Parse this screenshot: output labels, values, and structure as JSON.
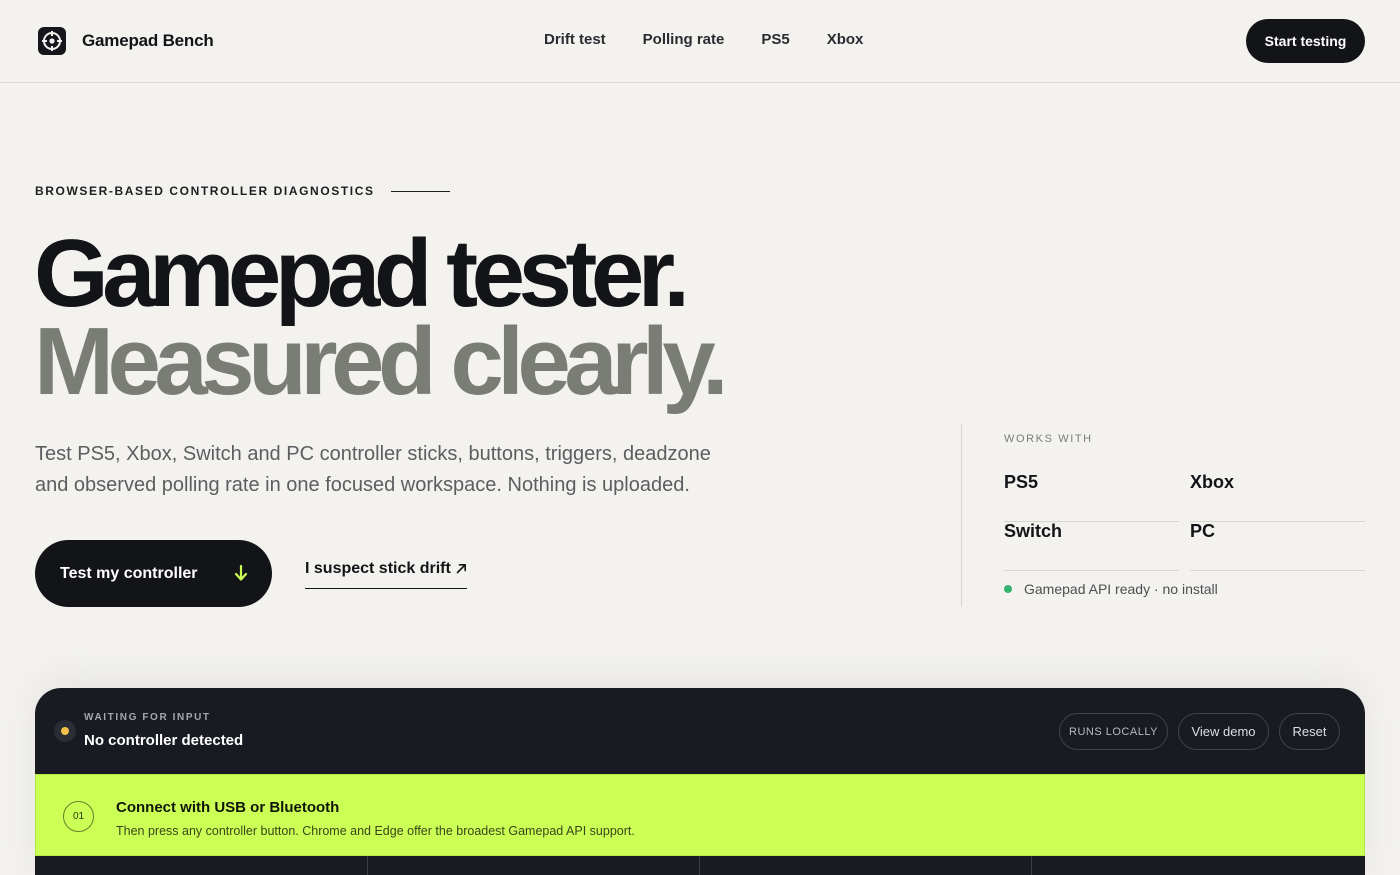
{
  "header": {
    "brand_name": "Gamepad Bench",
    "nav": [
      "Drift test",
      "Polling rate",
      "PS5",
      "Xbox"
    ],
    "cta_label": "Start testing"
  },
  "hero": {
    "eyebrow": "BROWSER-BASED CONTROLLER DIAGNOSTICS",
    "title_line1": "Gamepad tester.",
    "title_line2": "Measured clearly.",
    "lead": "Test PS5, Xbox, Switch and PC controller sticks, buttons, triggers, deadzone and observed polling rate in one focused workspace. Nothing is uploaded.",
    "primary_label": "Test my controller",
    "secondary_label": "I suspect stick drift"
  },
  "works_with": {
    "label": "WORKS WITH",
    "platforms": [
      "PS5",
      "Xbox",
      "Switch",
      "PC"
    ],
    "status": "Gamepad API ready · no install"
  },
  "tester": {
    "state_eyebrow": "WAITING FOR INPUT",
    "state_title": "No controller detected",
    "badge": "RUNS LOCALLY",
    "demo_label": "View demo",
    "reset_label": "Reset",
    "step_number": "01",
    "connect_title": "Connect with USB or Bluetooth",
    "connect_sub": "Then press any controller button. Chrome and Edge offer the broadest Gamepad API support."
  },
  "colors": {
    "background": "#f3f2ee",
    "ink": "#121418",
    "muted_title": "#7a7d76",
    "accent": "#cbff55",
    "ready": "#33b36b",
    "waiting": "#f2c14a"
  }
}
